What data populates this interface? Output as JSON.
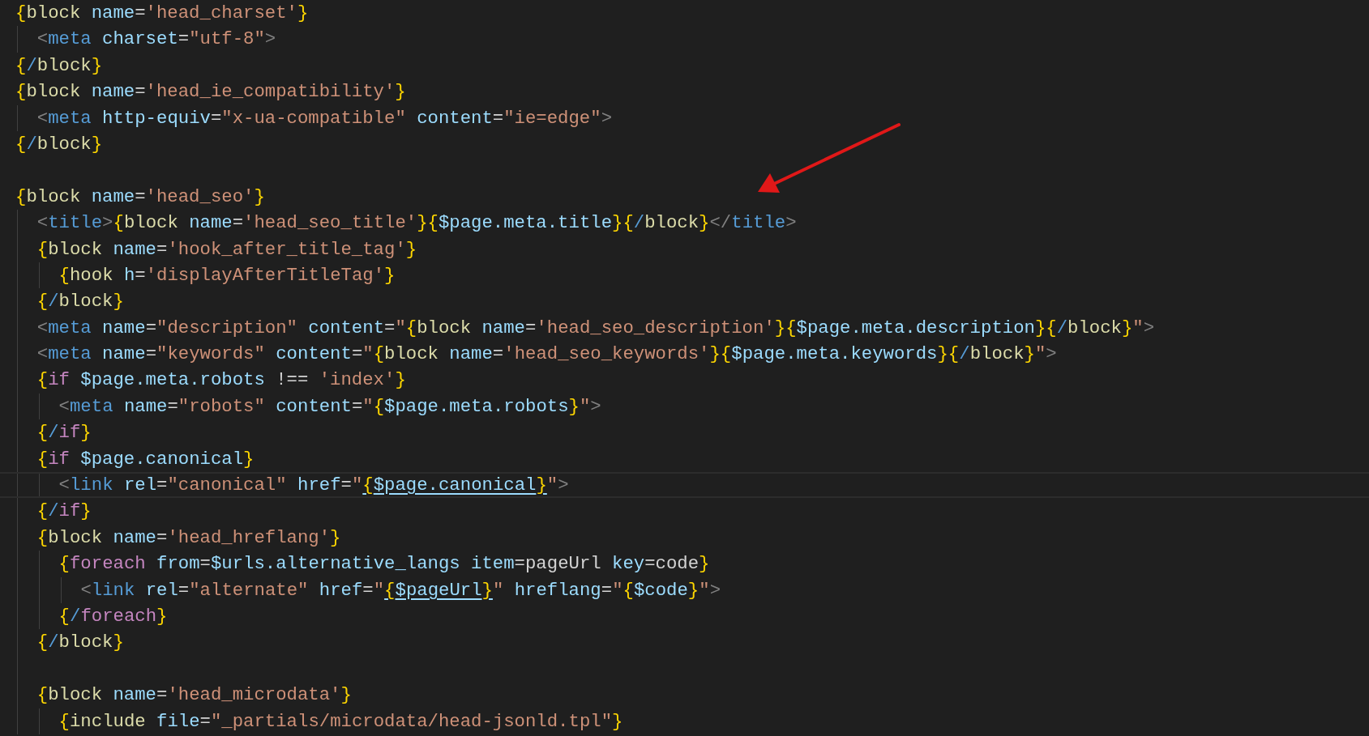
{
  "editor": {
    "lines": [
      {
        "current": false,
        "tokens": [
          {
            "kind": "brace",
            "text": "{"
          },
          {
            "kind": "kw",
            "text": "block"
          },
          {
            "kind": "attr",
            "text": " name"
          },
          {
            "kind": "plain",
            "text": "="
          },
          {
            "kind": "str",
            "text": "'head_charset'"
          },
          {
            "kind": "brace",
            "text": "}"
          }
        ],
        "children": [
          {
            "current": false,
            "tokens": [
              {
                "kind": "punct",
                "text": "<"
              },
              {
                "kind": "tag",
                "text": "meta"
              },
              {
                "kind": "attr",
                "text": " charset"
              },
              {
                "kind": "plain",
                "text": "="
              },
              {
                "kind": "str",
                "text": "\"utf-8\""
              },
              {
                "kind": "punct",
                "text": ">"
              }
            ]
          }
        ]
      },
      {
        "current": false,
        "tokens": [
          {
            "kind": "brace",
            "text": "{"
          },
          {
            "kind": "slash",
            "text": "/"
          },
          {
            "kind": "kw",
            "text": "block"
          },
          {
            "kind": "brace",
            "text": "}"
          }
        ]
      },
      {
        "current": false,
        "tokens": [
          {
            "kind": "brace",
            "text": "{"
          },
          {
            "kind": "kw",
            "text": "block"
          },
          {
            "kind": "attr",
            "text": " name"
          },
          {
            "kind": "plain",
            "text": "="
          },
          {
            "kind": "str",
            "text": "'head_ie_compatibility'"
          },
          {
            "kind": "brace",
            "text": "}"
          }
        ],
        "children": [
          {
            "current": false,
            "tokens": [
              {
                "kind": "punct",
                "text": "<"
              },
              {
                "kind": "tag",
                "text": "meta"
              },
              {
                "kind": "attr",
                "text": " http-equiv"
              },
              {
                "kind": "plain",
                "text": "="
              },
              {
                "kind": "str",
                "text": "\"x-ua-compatible\""
              },
              {
                "kind": "attr",
                "text": " content"
              },
              {
                "kind": "plain",
                "text": "="
              },
              {
                "kind": "str",
                "text": "\"ie=edge\""
              },
              {
                "kind": "punct",
                "text": ">"
              }
            ]
          }
        ]
      },
      {
        "current": false,
        "tokens": [
          {
            "kind": "brace",
            "text": "{"
          },
          {
            "kind": "slash",
            "text": "/"
          },
          {
            "kind": "kw",
            "text": "block"
          },
          {
            "kind": "brace",
            "text": "}"
          }
        ]
      },
      {
        "current": false
      },
      {
        "current": false,
        "tokens": [
          {
            "kind": "brace",
            "text": "{"
          },
          {
            "kind": "kw",
            "text": "block"
          },
          {
            "kind": "attr",
            "text": " name"
          },
          {
            "kind": "plain",
            "text": "="
          },
          {
            "kind": "str",
            "text": "'head_seo'"
          },
          {
            "kind": "brace",
            "text": "}"
          }
        ],
        "children": [
          {
            "current": false,
            "tokens": [
              {
                "kind": "punct",
                "text": "<"
              },
              {
                "kind": "tag",
                "text": "title"
              },
              {
                "kind": "punct",
                "text": ">"
              },
              {
                "kind": "brace",
                "text": "{"
              },
              {
                "kind": "kw",
                "text": "block"
              },
              {
                "kind": "attr",
                "text": " name"
              },
              {
                "kind": "plain",
                "text": "="
              },
              {
                "kind": "str",
                "text": "'head_seo_title'"
              },
              {
                "kind": "brace",
                "text": "}{"
              },
              {
                "kind": "var",
                "text": "$page.meta.title"
              },
              {
                "kind": "brace",
                "text": "}{"
              },
              {
                "kind": "slash",
                "text": "/"
              },
              {
                "kind": "kw",
                "text": "block"
              },
              {
                "kind": "brace",
                "text": "}"
              },
              {
                "kind": "punct",
                "text": "</"
              },
              {
                "kind": "tag",
                "text": "title"
              },
              {
                "kind": "punct",
                "text": ">"
              }
            ]
          },
          {
            "current": false,
            "tokens": [
              {
                "kind": "brace",
                "text": "{"
              },
              {
                "kind": "kw",
                "text": "block"
              },
              {
                "kind": "attr",
                "text": " name"
              },
              {
                "kind": "plain",
                "text": "="
              },
              {
                "kind": "str",
                "text": "'hook_after_title_tag'"
              },
              {
                "kind": "brace",
                "text": "}"
              }
            ],
            "children": [
              {
                "current": false,
                "tokens": [
                  {
                    "kind": "brace",
                    "text": "{"
                  },
                  {
                    "kind": "kw",
                    "text": "hook"
                  },
                  {
                    "kind": "attr",
                    "text": " h"
                  },
                  {
                    "kind": "plain",
                    "text": "="
                  },
                  {
                    "kind": "str",
                    "text": "'displayAfterTitleTag'"
                  },
                  {
                    "kind": "brace",
                    "text": "}"
                  }
                ]
              }
            ]
          },
          {
            "current": false,
            "tokens": [
              {
                "kind": "brace",
                "text": "{"
              },
              {
                "kind": "slash",
                "text": "/"
              },
              {
                "kind": "kw",
                "text": "block"
              },
              {
                "kind": "brace",
                "text": "}"
              }
            ]
          },
          {
            "current": false,
            "tokens": [
              {
                "kind": "punct",
                "text": "<"
              },
              {
                "kind": "tag",
                "text": "meta"
              },
              {
                "kind": "attr",
                "text": " name"
              },
              {
                "kind": "plain",
                "text": "="
              },
              {
                "kind": "str",
                "text": "\"description\""
              },
              {
                "kind": "attr",
                "text": " content"
              },
              {
                "kind": "plain",
                "text": "="
              },
              {
                "kind": "str",
                "text": "\""
              },
              {
                "kind": "brace",
                "text": "{"
              },
              {
                "kind": "kw",
                "text": "block"
              },
              {
                "kind": "attr",
                "text": " name"
              },
              {
                "kind": "plain",
                "text": "="
              },
              {
                "kind": "str",
                "text": "'head_seo_description'"
              },
              {
                "kind": "brace",
                "text": "}{"
              },
              {
                "kind": "var",
                "text": "$page.meta.description"
              },
              {
                "kind": "brace",
                "text": "}{"
              },
              {
                "kind": "slash",
                "text": "/"
              },
              {
                "kind": "kw",
                "text": "block"
              },
              {
                "kind": "brace",
                "text": "}"
              },
              {
                "kind": "str",
                "text": "\""
              },
              {
                "kind": "punct",
                "text": ">"
              }
            ]
          },
          {
            "current": false,
            "tokens": [
              {
                "kind": "punct",
                "text": "<"
              },
              {
                "kind": "tag",
                "text": "meta"
              },
              {
                "kind": "attr",
                "text": " name"
              },
              {
                "kind": "plain",
                "text": "="
              },
              {
                "kind": "str",
                "text": "\"keywords\""
              },
              {
                "kind": "attr",
                "text": " content"
              },
              {
                "kind": "plain",
                "text": "="
              },
              {
                "kind": "str",
                "text": "\""
              },
              {
                "kind": "brace",
                "text": "{"
              },
              {
                "kind": "kw",
                "text": "block"
              },
              {
                "kind": "attr",
                "text": " name"
              },
              {
                "kind": "plain",
                "text": "="
              },
              {
                "kind": "str",
                "text": "'head_seo_keywords'"
              },
              {
                "kind": "brace",
                "text": "}{"
              },
              {
                "kind": "var",
                "text": "$page.meta.keywords"
              },
              {
                "kind": "brace",
                "text": "}{"
              },
              {
                "kind": "slash",
                "text": "/"
              },
              {
                "kind": "kw",
                "text": "block"
              },
              {
                "kind": "brace",
                "text": "}"
              },
              {
                "kind": "str",
                "text": "\""
              },
              {
                "kind": "punct",
                "text": ">"
              }
            ]
          },
          {
            "current": false,
            "tokens": [
              {
                "kind": "brace",
                "text": "{"
              },
              {
                "kind": "ctl",
                "text": "if"
              },
              {
                "kind": "var",
                "text": " $page.meta.robots"
              },
              {
                "kind": "plain",
                "text": " !== "
              },
              {
                "kind": "str",
                "text": "'index'"
              },
              {
                "kind": "brace",
                "text": "}"
              }
            ],
            "children": [
              {
                "current": false,
                "tokens": [
                  {
                    "kind": "punct",
                    "text": "<"
                  },
                  {
                    "kind": "tag",
                    "text": "meta"
                  },
                  {
                    "kind": "attr",
                    "text": " name"
                  },
                  {
                    "kind": "plain",
                    "text": "="
                  },
                  {
                    "kind": "str",
                    "text": "\"robots\""
                  },
                  {
                    "kind": "attr",
                    "text": " content"
                  },
                  {
                    "kind": "plain",
                    "text": "="
                  },
                  {
                    "kind": "str",
                    "text": "\""
                  },
                  {
                    "kind": "brace",
                    "text": "{"
                  },
                  {
                    "kind": "var",
                    "text": "$page.meta.robots"
                  },
                  {
                    "kind": "brace",
                    "text": "}"
                  },
                  {
                    "kind": "str",
                    "text": "\""
                  },
                  {
                    "kind": "punct",
                    "text": ">"
                  }
                ]
              }
            ]
          },
          {
            "current": false,
            "tokens": [
              {
                "kind": "brace",
                "text": "{"
              },
              {
                "kind": "slash",
                "text": "/"
              },
              {
                "kind": "ctl",
                "text": "if"
              },
              {
                "kind": "brace",
                "text": "}"
              }
            ]
          },
          {
            "current": false,
            "tokens": [
              {
                "kind": "brace",
                "text": "{"
              },
              {
                "kind": "ctl",
                "text": "if"
              },
              {
                "kind": "var",
                "text": " $page.canonical"
              },
              {
                "kind": "brace",
                "text": "}"
              }
            ],
            "children": [
              {
                "current": true,
                "tokens": [
                  {
                    "kind": "punct",
                    "text": "<"
                  },
                  {
                    "kind": "tag",
                    "text": "link"
                  },
                  {
                    "kind": "attr",
                    "text": " rel"
                  },
                  {
                    "kind": "plain",
                    "text": "="
                  },
                  {
                    "kind": "str",
                    "text": "\"canonical\""
                  },
                  {
                    "kind": "attr",
                    "text": " href"
                  },
                  {
                    "kind": "plain",
                    "text": "="
                  },
                  {
                    "kind": "str",
                    "text": "\""
                  },
                  {
                    "kind": "brace",
                    "text": "{",
                    "link": true
                  },
                  {
                    "kind": "var",
                    "text": "$page.canonical",
                    "link": true
                  },
                  {
                    "kind": "brace",
                    "text": "}",
                    "link": true
                  },
                  {
                    "kind": "str",
                    "text": "\""
                  },
                  {
                    "kind": "punct",
                    "text": ">"
                  }
                ]
              }
            ]
          },
          {
            "current": false,
            "tokens": [
              {
                "kind": "brace",
                "text": "{"
              },
              {
                "kind": "slash",
                "text": "/"
              },
              {
                "kind": "ctl",
                "text": "if"
              },
              {
                "kind": "brace",
                "text": "}"
              }
            ]
          },
          {
            "current": false,
            "tokens": [
              {
                "kind": "brace",
                "text": "{"
              },
              {
                "kind": "kw",
                "text": "block"
              },
              {
                "kind": "attr",
                "text": " name"
              },
              {
                "kind": "plain",
                "text": "="
              },
              {
                "kind": "str",
                "text": "'head_hreflang'"
              },
              {
                "kind": "brace",
                "text": "}"
              }
            ],
            "children": [
              {
                "current": false,
                "tokens": [
                  {
                    "kind": "brace",
                    "text": "{"
                  },
                  {
                    "kind": "ctl",
                    "text": "foreach"
                  },
                  {
                    "kind": "attr",
                    "text": " from"
                  },
                  {
                    "kind": "plain",
                    "text": "="
                  },
                  {
                    "kind": "var",
                    "text": "$urls.alternative_langs"
                  },
                  {
                    "kind": "attr",
                    "text": " item"
                  },
                  {
                    "kind": "plain",
                    "text": "=pageUrl"
                  },
                  {
                    "kind": "attr",
                    "text": " key"
                  },
                  {
                    "kind": "plain",
                    "text": "=code"
                  },
                  {
                    "kind": "brace",
                    "text": "}"
                  }
                ],
                "children": [
                  {
                    "current": false,
                    "tokens": [
                      {
                        "kind": "punct",
                        "text": "<"
                      },
                      {
                        "kind": "tag",
                        "text": "link"
                      },
                      {
                        "kind": "attr",
                        "text": " rel"
                      },
                      {
                        "kind": "plain",
                        "text": "="
                      },
                      {
                        "kind": "str",
                        "text": "\"alternate\""
                      },
                      {
                        "kind": "attr",
                        "text": " href"
                      },
                      {
                        "kind": "plain",
                        "text": "="
                      },
                      {
                        "kind": "str",
                        "text": "\""
                      },
                      {
                        "kind": "brace",
                        "text": "{",
                        "link": true
                      },
                      {
                        "kind": "var",
                        "text": "$pageUrl",
                        "link": true
                      },
                      {
                        "kind": "brace",
                        "text": "}",
                        "link": true
                      },
                      {
                        "kind": "str",
                        "text": "\""
                      },
                      {
                        "kind": "attr",
                        "text": " hreflang"
                      },
                      {
                        "kind": "plain",
                        "text": "="
                      },
                      {
                        "kind": "str",
                        "text": "\""
                      },
                      {
                        "kind": "brace",
                        "text": "{"
                      },
                      {
                        "kind": "var",
                        "text": "$code"
                      },
                      {
                        "kind": "brace",
                        "text": "}"
                      },
                      {
                        "kind": "str",
                        "text": "\""
                      },
                      {
                        "kind": "punct",
                        "text": ">"
                      }
                    ]
                  }
                ]
              },
              {
                "current": false,
                "tokens": [
                  {
                    "kind": "brace",
                    "text": "{"
                  },
                  {
                    "kind": "slash",
                    "text": "/"
                  },
                  {
                    "kind": "ctl",
                    "text": "foreach"
                  },
                  {
                    "kind": "brace",
                    "text": "}"
                  }
                ]
              }
            ]
          },
          {
            "current": false,
            "tokens": [
              {
                "kind": "brace",
                "text": "{"
              },
              {
                "kind": "slash",
                "text": "/"
              },
              {
                "kind": "kw",
                "text": "block"
              },
              {
                "kind": "brace",
                "text": "}"
              }
            ]
          },
          {
            "current": false
          },
          {
            "current": false,
            "tokens": [
              {
                "kind": "brace",
                "text": "{"
              },
              {
                "kind": "kw",
                "text": "block"
              },
              {
                "kind": "attr",
                "text": " name"
              },
              {
                "kind": "plain",
                "text": "="
              },
              {
                "kind": "str",
                "text": "'head_microdata'"
              },
              {
                "kind": "brace",
                "text": "}"
              }
            ],
            "children": [
              {
                "current": false,
                "tokens": [
                  {
                    "kind": "brace",
                    "text": "{"
                  },
                  {
                    "kind": "kw",
                    "text": "include"
                  },
                  {
                    "kind": "attr",
                    "text": " file"
                  },
                  {
                    "kind": "plain",
                    "text": "="
                  },
                  {
                    "kind": "str",
                    "text": "\"_partials/microdata/head-jsonld.tpl\""
                  },
                  {
                    "kind": "brace",
                    "text": "}"
                  }
                ]
              }
            ]
          }
        ]
      }
    ]
  }
}
